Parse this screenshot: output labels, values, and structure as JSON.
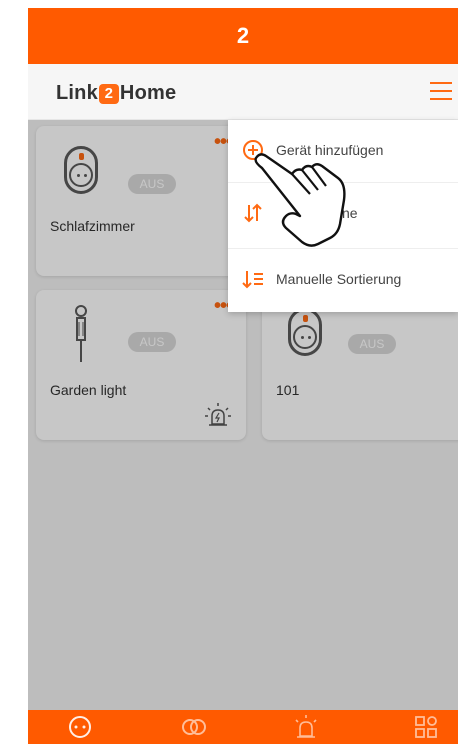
{
  "step_number": "2",
  "header": {
    "logo_left": "Link",
    "logo_digit": "2",
    "logo_right": "Home"
  },
  "menu": {
    "items": [
      {
        "label": "Gerät hinzufügen",
        "icon": "plus-circle-icon"
      },
      {
        "label": "ne",
        "icon": "sort-arrows-icon"
      },
      {
        "label": "Manuelle Sortierung",
        "icon": "sort-list-icon"
      }
    ]
  },
  "devices": [
    {
      "name": "Schlafzimmer",
      "status": "AUS",
      "icon": "smart-plug-icon"
    },
    {
      "name": "Garden light",
      "status": "AUS",
      "icon": "garden-light-icon"
    },
    {
      "name": "101",
      "status": "AUS",
      "icon": "smart-plug-icon"
    }
  ],
  "tabbar": {
    "tabs": [
      "devices-tab-icon",
      "scenes-tab-icon",
      "alarm-tab-icon",
      "more-tab-icon"
    ]
  },
  "colors": {
    "accent": "#ff5a00",
    "badge": "#d9d9d9",
    "text": "#333333"
  }
}
